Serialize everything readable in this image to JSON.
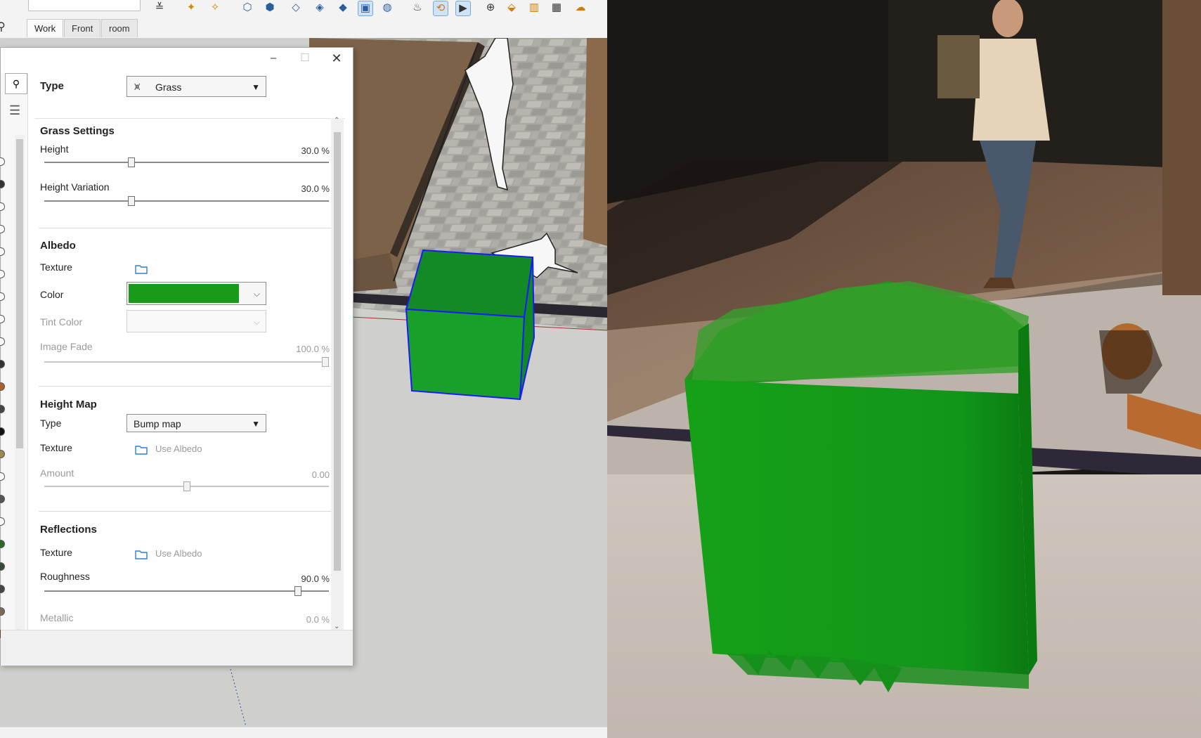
{
  "scene_tabs": [
    "Work",
    "Front",
    "room"
  ],
  "dialog": {
    "type_label": "Type",
    "type_value": "Grass",
    "sections": {
      "grass_settings": {
        "title": "Grass Settings",
        "height_label": "Height",
        "height_value": "30.0 %",
        "height_level": 0.3,
        "variation_label": "Height Variation",
        "variation_value": "30.0 %",
        "variation_level": 0.3
      },
      "albedo": {
        "title": "Albedo",
        "texture_label": "Texture",
        "color_label": "Color",
        "color_value": "#1a9a1a",
        "tint_label": "Tint Color",
        "fade_label": "Image Fade",
        "fade_value": "100.0 %",
        "fade_level": 1.0
      },
      "height_map": {
        "title": "Height Map",
        "type_label": "Type",
        "type_value": "Bump map",
        "texture_label": "Texture",
        "texture_value": "Use Albedo",
        "amount_label": "Amount",
        "amount_value": "0.00",
        "amount_level": 0.5
      },
      "reflections": {
        "title": "Reflections",
        "texture_label": "Texture",
        "texture_value": "Use Albedo",
        "roughness_label": "Roughness",
        "roughness_value": "90.0 %",
        "roughness_level": 0.9,
        "metallic_label": "Metallic",
        "metallic_value": "0.0 %"
      }
    }
  },
  "colors": {
    "grass_green": "#1a9a1a",
    "cube_edge": "#1a1aff",
    "accent_blue": "#2f7fd0"
  },
  "icons": [
    "search-icon",
    "hamburger-menu-icon",
    "grass-icon",
    "folder-icon",
    "minimize-icon",
    "maximize-icon",
    "close-icon"
  ]
}
